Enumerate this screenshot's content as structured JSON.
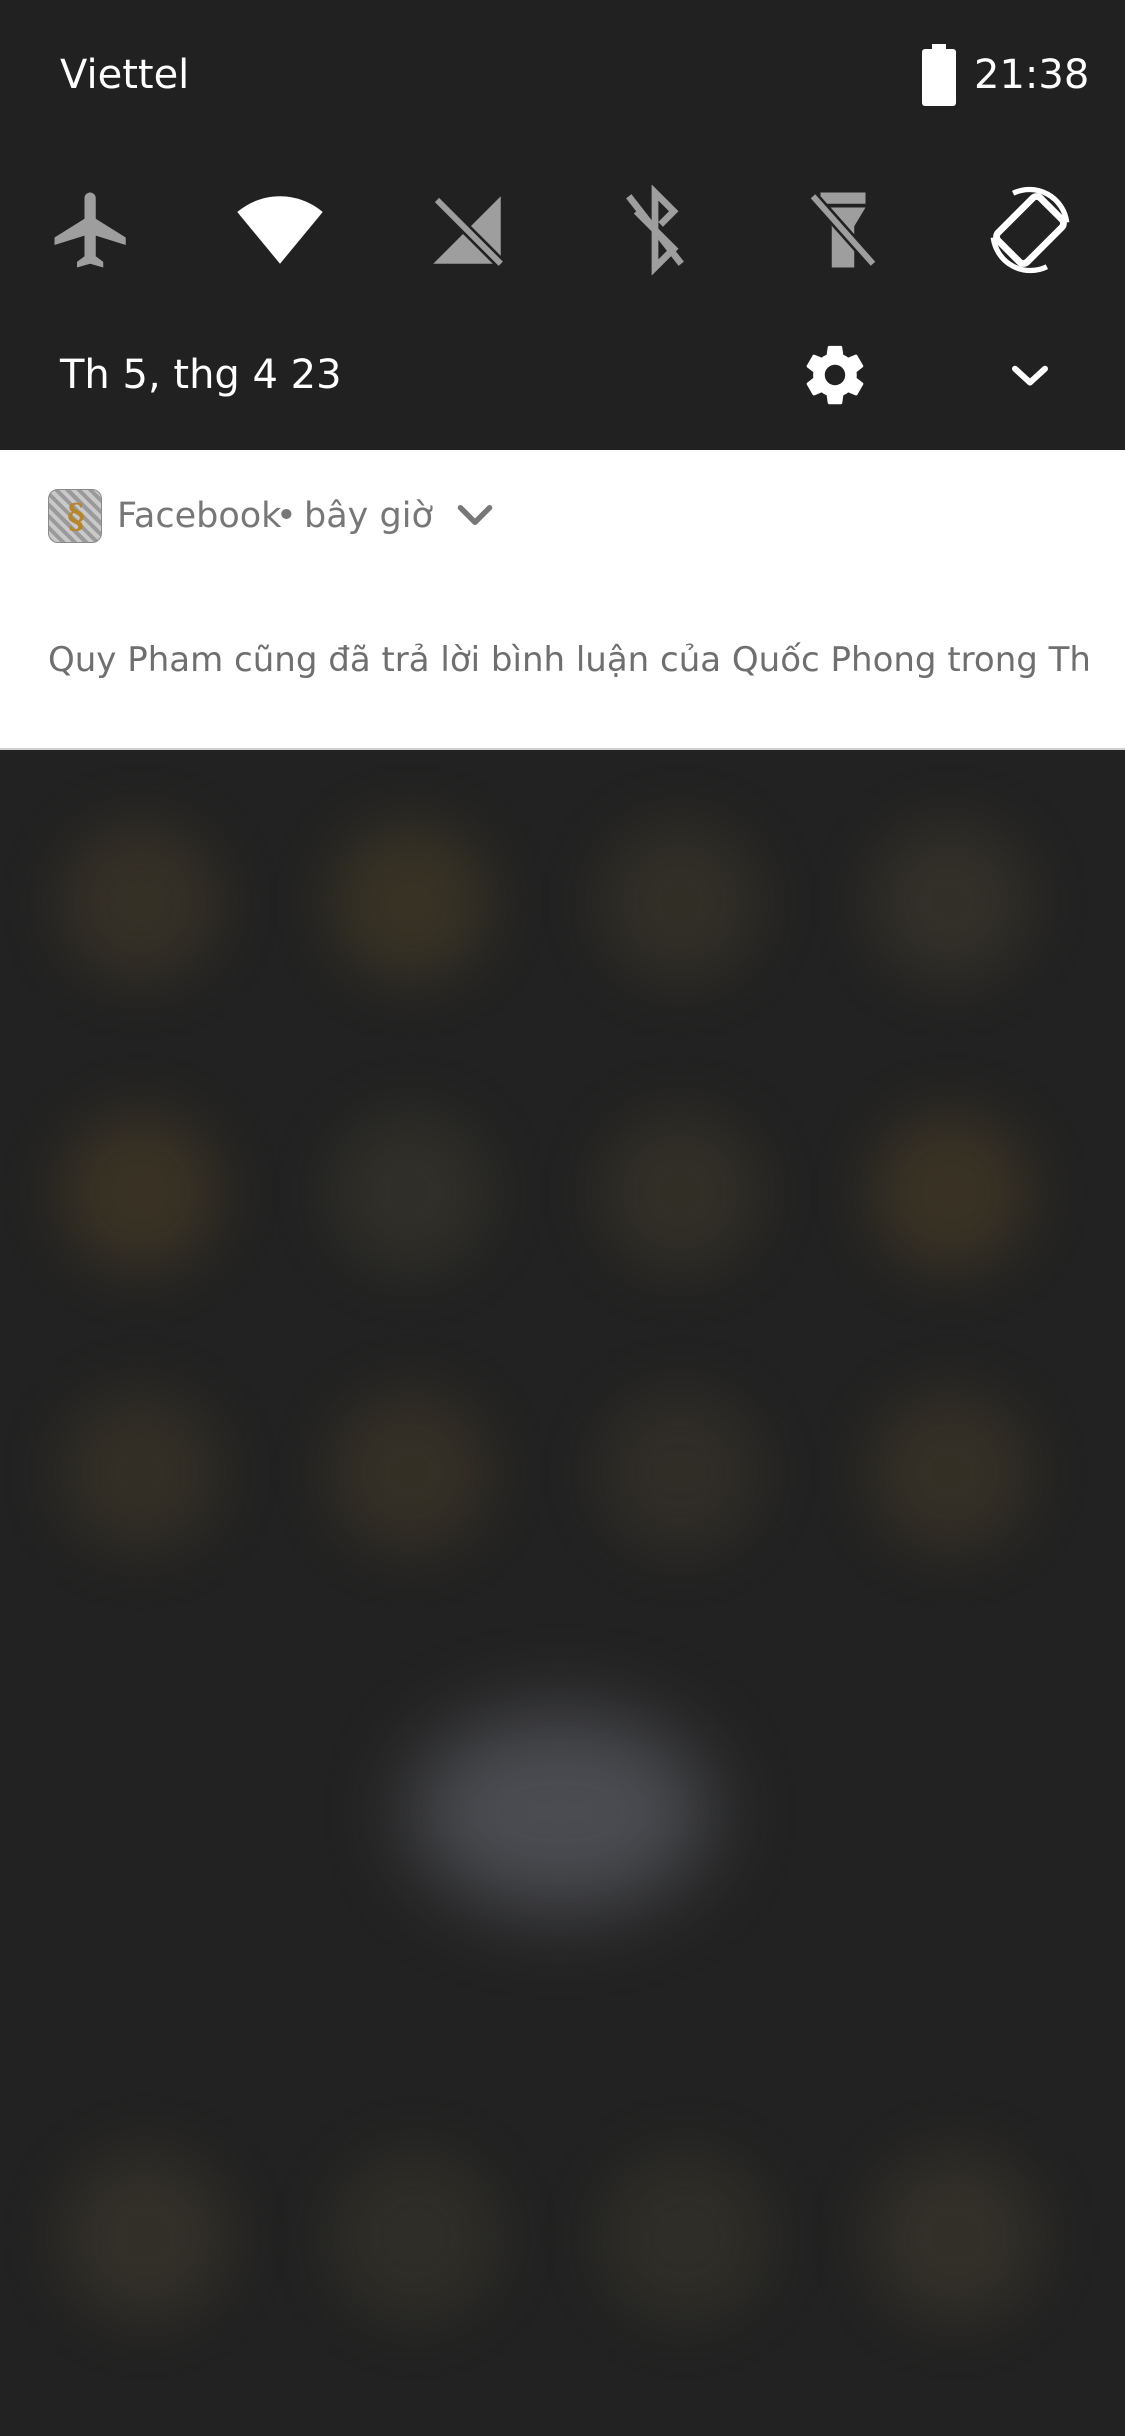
{
  "status_bar": {
    "carrier": "Viettel",
    "time": "21:38",
    "battery_icon": "battery-full-icon"
  },
  "quick_settings": {
    "tiles": [
      {
        "name": "airplane-mode",
        "icon": "airplane-icon",
        "state": "off"
      },
      {
        "name": "wifi",
        "icon": "wifi-icon",
        "state": "on"
      },
      {
        "name": "mobile-data",
        "icon": "signal-off-icon",
        "state": "off"
      },
      {
        "name": "bluetooth",
        "icon": "bluetooth-off-icon",
        "state": "off"
      },
      {
        "name": "flashlight",
        "icon": "flashlight-off-icon",
        "state": "off"
      },
      {
        "name": "auto-rotate",
        "icon": "screen-rotation-icon",
        "state": "on"
      }
    ],
    "date": "Th 5, thg 4 23",
    "settings_icon": "gear-icon",
    "expand_icon": "chevron-down-icon"
  },
  "notification": {
    "app_name": "Facebook",
    "separator": "•",
    "time": "bây giờ",
    "body": "Quy Pham cũng đã trả lời bình luận của Quốc Phong trong Thủ..."
  },
  "colors": {
    "panel_bg": "#212121",
    "tile_active": "#ffffff",
    "tile_inactive": "#9e9e9e",
    "notification_bg": "#ffffff",
    "notification_text": "#777777"
  }
}
